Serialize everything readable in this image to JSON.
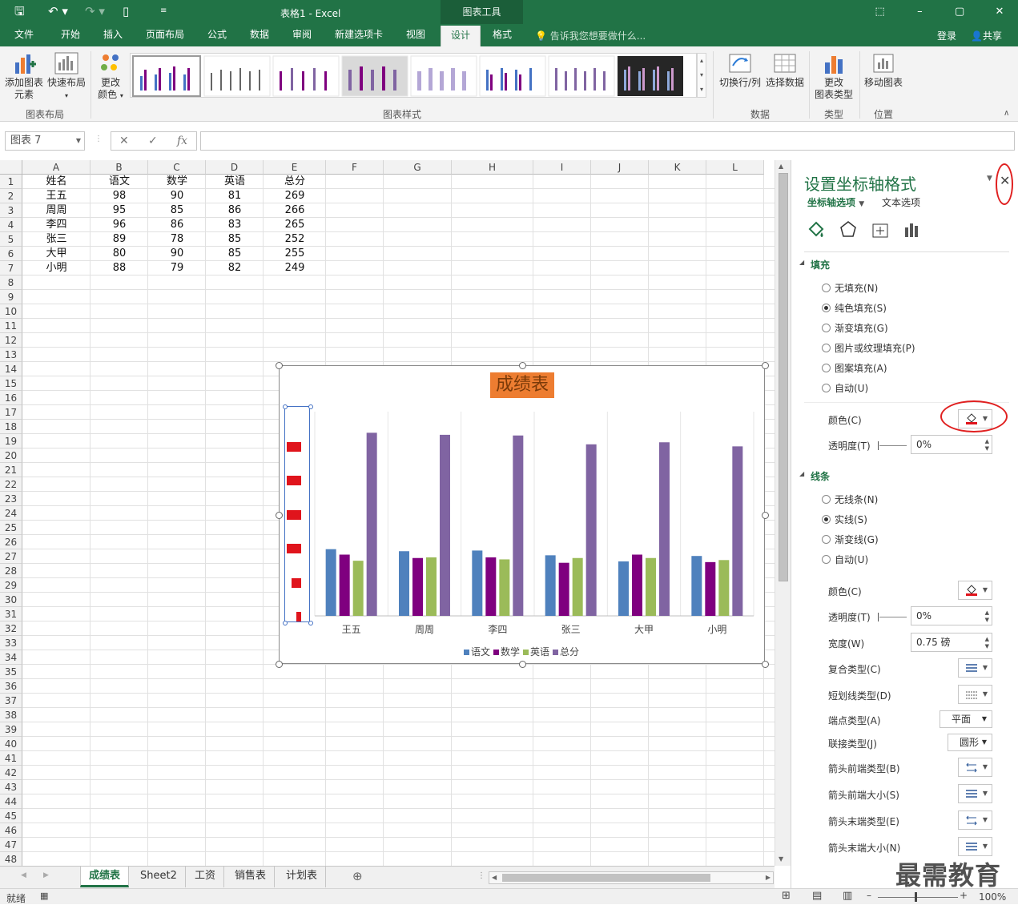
{
  "window": {
    "title": "表格1 - Excel",
    "context_tab": "图表工具"
  },
  "tabs": [
    "文件",
    "开始",
    "插入",
    "页面布局",
    "公式",
    "数据",
    "审阅",
    "新建选项卡",
    "视图",
    "设计",
    "格式"
  ],
  "tellme": "告诉我您想要做什么...",
  "signin": "登录",
  "share": "共享",
  "ribbon": {
    "add_element": "添加图表\n元素",
    "quick_layout": "快速布局",
    "change_colors": "更改\n颜色",
    "group_layout": "图表布局",
    "group_styles": "图表样式",
    "switch_rowcol": "切换行/列",
    "select_data": "选择数据",
    "group_data": "数据",
    "change_type": "更改\n图表类型",
    "group_type": "类型",
    "move_chart": "移动图表",
    "group_location": "位置"
  },
  "namebox": "图表 7",
  "fx": "fx",
  "columns": [
    "A",
    "B",
    "C",
    "D",
    "E",
    "F",
    "G",
    "H",
    "I",
    "J",
    "K",
    "L"
  ],
  "table": [
    [
      "姓名",
      "语文",
      "数学",
      "英语",
      "总分"
    ],
    [
      "王五",
      "98",
      "90",
      "81",
      "269"
    ],
    [
      "周周",
      "95",
      "85",
      "86",
      "266"
    ],
    [
      "李四",
      "96",
      "86",
      "83",
      "265"
    ],
    [
      "张三",
      "89",
      "78",
      "85",
      "252"
    ],
    [
      "大甲",
      "80",
      "90",
      "85",
      "255"
    ],
    [
      "小明",
      "88",
      "79",
      "82",
      "249"
    ]
  ],
  "row_count": 48,
  "chart_data": {
    "type": "bar",
    "title": "成绩表",
    "categories": [
      "王五",
      "周周",
      "李四",
      "张三",
      "大甲",
      "小明"
    ],
    "series": [
      {
        "name": "语文",
        "color": "#4f81bd",
        "values": [
          98,
          95,
          96,
          89,
          80,
          88
        ]
      },
      {
        "name": "数学",
        "color": "#7f007f",
        "values": [
          90,
          85,
          86,
          78,
          90,
          79
        ]
      },
      {
        "name": "英语",
        "color": "#9bbb59",
        "values": [
          81,
          86,
          83,
          85,
          85,
          82
        ]
      },
      {
        "name": "总分",
        "color": "#8064a2",
        "values": [
          269,
          266,
          265,
          252,
          255,
          249
        ]
      }
    ],
    "ylim": [
      0,
      300
    ],
    "grid": true,
    "legend": "bottom"
  },
  "sheets": [
    "成绩表",
    "Sheet2",
    "工资",
    "销售表",
    "计划表"
  ],
  "status": {
    "ready": "就绪",
    "zoom": "100%"
  },
  "pane": {
    "title": "设置坐标轴格式",
    "tab_axis": "坐标轴选项",
    "tab_text": "文本选项",
    "fill_section": "填充",
    "fill_options": [
      "无填充(N)",
      "纯色填充(S)",
      "渐变填充(G)",
      "图片或纹理填充(P)",
      "图案填充(A)",
      "自动(U)"
    ],
    "fill_selected": 1,
    "color_label": "颜色(C)",
    "transparency_label": "透明度(T)",
    "transparency_value": "0%",
    "line_section": "线条",
    "line_options": [
      "无线条(N)",
      "实线(S)",
      "渐变线(G)",
      "自动(U)"
    ],
    "line_selected": 1,
    "line_color_label": "颜色(C)",
    "line_transparency_label": "透明度(T)",
    "line_transparency_value": "0%",
    "width_label": "宽度(W)",
    "width_value": "0.75 磅",
    "compound_label": "复合类型(C)",
    "dash_label": "短划线类型(D)",
    "cap_label": "端点类型(A)",
    "cap_value": "平面",
    "join_label": "联接类型(J)",
    "join_value": "圆形",
    "arrow_begin_type": "箭头前端类型(B)",
    "arrow_begin_size": "箭头前端大小(S)",
    "arrow_end_type": "箭头末端类型(E)",
    "arrow_end_size": "箭头末端大小(N)"
  },
  "watermark": "最需教育"
}
